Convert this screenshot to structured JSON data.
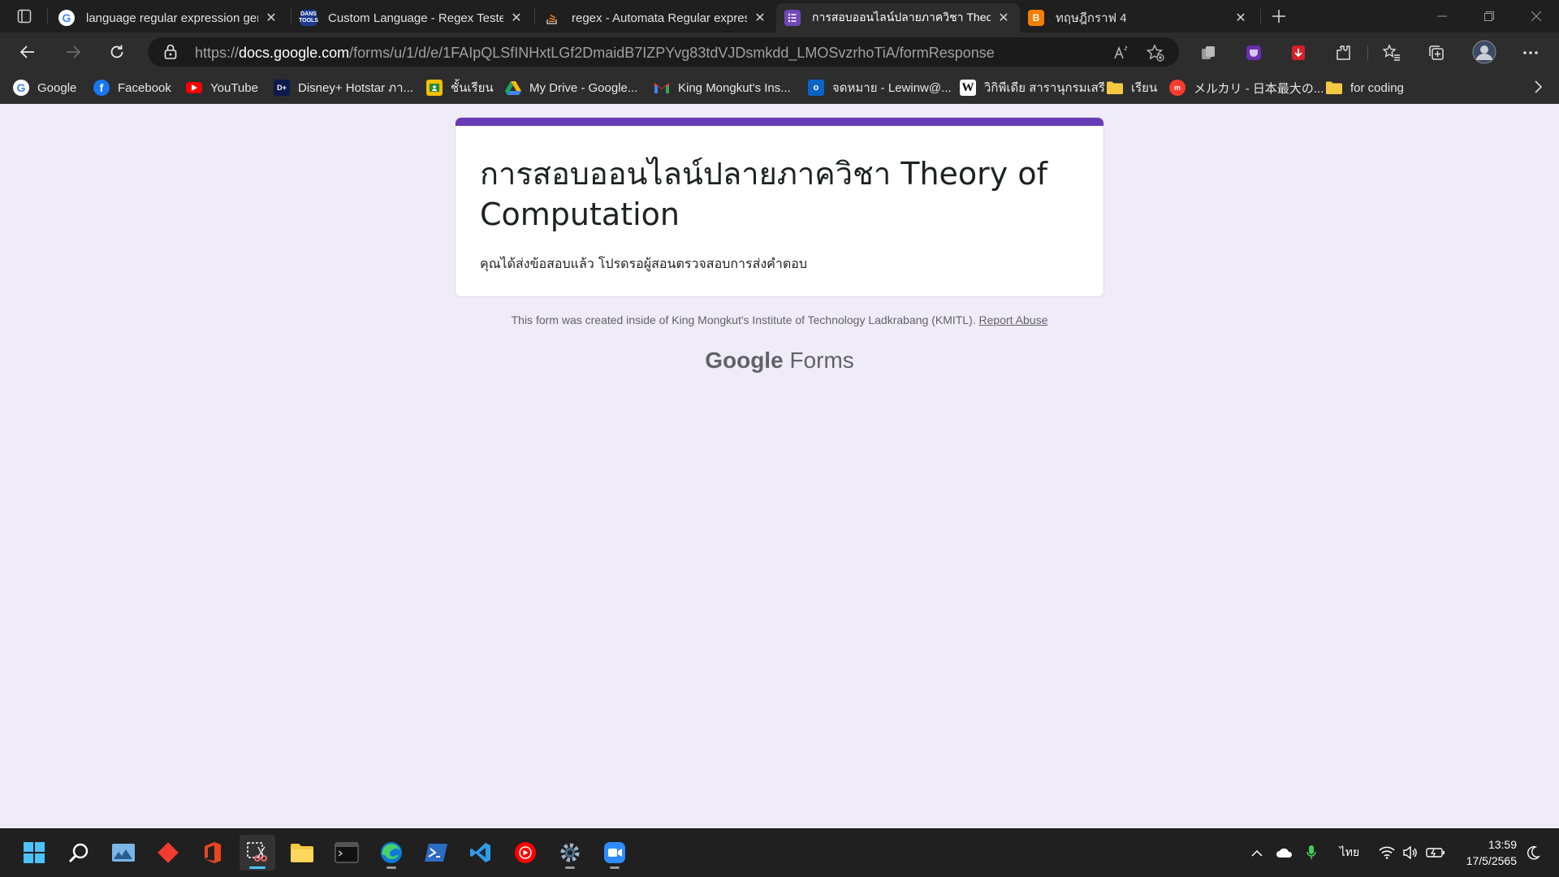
{
  "browser": {
    "tabs": [
      {
        "title": "language regular expression gen",
        "favicon": "google-icon",
        "color": "#ffffff"
      },
      {
        "title": "Custom Language - Regex Tester",
        "favicon": "dans-tools-icon",
        "color": "#1a3a8f"
      },
      {
        "title": "regex - Automata Regular expres",
        "favicon": "stackoverflow-icon",
        "color": "#f48024"
      },
      {
        "title": "การสอบออนไลน์ปลายภาควิชา Theory",
        "favicon": "google-forms-icon",
        "color": "#7248b9",
        "active": true
      },
      {
        "title": "ทฤษฎีกราฟ 4",
        "favicon": "blogger-icon",
        "color": "#f57d00"
      }
    ],
    "address": {
      "scheme": "https://",
      "host": "docs.google.com",
      "path": "/forms/u/1/d/e/1FAIpQLSfINHxtLGf2DmaidB7IZPYvg83tdVJDsmkdd_LMOSvzrhoTiA/formResponse"
    },
    "bookmarks": [
      {
        "label": "Google",
        "icon": "google-icon",
        "color": "#ffffff"
      },
      {
        "label": "Facebook",
        "icon": "facebook-icon",
        "color": "#1877f2"
      },
      {
        "label": "YouTube",
        "icon": "youtube-icon",
        "color": "#ff0000"
      },
      {
        "label": "Disney+ Hotstar ภา...",
        "icon": "hotstar-icon",
        "color": "#0c1a4b"
      },
      {
        "label": "ชั้นเรียน",
        "icon": "classroom-icon",
        "color": "#f8bc00"
      },
      {
        "label": "My Drive - Google...",
        "icon": "drive-icon",
        "color": "#1fa463"
      },
      {
        "label": "King Mongkut's Ins...",
        "icon": "gmail-icon",
        "color": "#ea4335"
      },
      {
        "label": "จดหมาย - Lewinw@...",
        "icon": "outlook-icon",
        "color": "#0a64c8"
      },
      {
        "label": "วิกิพีเดีย สารานุกรมเสรี",
        "icon": "wikipedia-icon",
        "color": "#ffffff"
      },
      {
        "label": "เรียน",
        "icon": "folder-icon",
        "color": "#f5c842"
      },
      {
        "label": "メルカリ - 日本最大の...",
        "icon": "mercari-icon",
        "color": "#ff3b30"
      },
      {
        "label": "for coding",
        "icon": "folder-icon",
        "color": "#f5c842"
      }
    ]
  },
  "form": {
    "title": "การสอบออนไลน์ปลายภาควิชา Theory of Computation",
    "confirmation": "คุณได้ส่งข้อสอบแล้ว โปรดรอผู้สอนตรวจสอบการส่งคำตอบ",
    "accent_color": "#673ab7",
    "footer_text": "This form was created inside of King Mongkut's Institute of Technology Ladkrabang (KMITL).",
    "report_abuse": "Report Abuse",
    "brand_google": "Google",
    "brand_forms": "Forms"
  },
  "taskbar": {
    "apps": [
      "windows-start-icon",
      "search-icon",
      "photos-icon",
      "git-icon",
      "office-icon",
      "snipping-tool-icon",
      "file-explorer-icon",
      "terminal-icon",
      "edge-icon",
      "powershell-icon",
      "vscode-icon",
      "youtube-music-icon",
      "settings-icon",
      "zoom-icon"
    ],
    "language": "ไทย",
    "time": "13:59",
    "date": "17/5/2565"
  }
}
